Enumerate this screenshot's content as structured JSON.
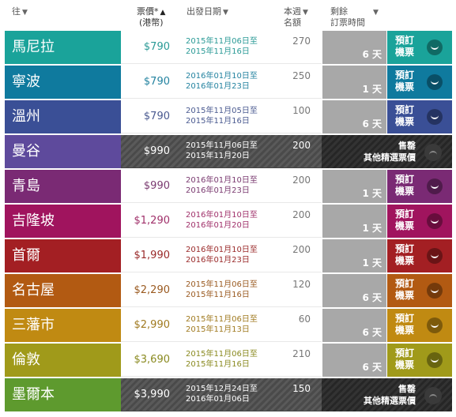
{
  "header": {
    "dest": "往",
    "price": "票價*",
    "price_sub": "(港幣)",
    "date": "出發日期",
    "quota": "本週",
    "quota_sub": "名額",
    "remain": "剩餘",
    "remain_sub": "訂票時間",
    "sort_arrow": "▼",
    "sort_active": "▲"
  },
  "labels": {
    "book_line1": "預訂",
    "book_line2": "機票",
    "sold_line1": "售罄",
    "sold_line2": "其他精選票價"
  },
  "rows": [
    {
      "dest": "馬尼拉",
      "price": "$790",
      "date_from": "2015年11月06日至",
      "date_to": "2015年11月16日",
      "quota": "270",
      "days": "6 天",
      "sold": false,
      "color": "#1aa39a",
      "text_color": "#2a9a96"
    },
    {
      "dest": "寧波",
      "price": "$790",
      "date_from": "2016年01月10日至",
      "date_to": "2016年01月23日",
      "quota": "250",
      "days": "1 天",
      "sold": false,
      "color": "#0f7a9e",
      "text_color": "#2483a0"
    },
    {
      "dest": "溫州",
      "price": "$790",
      "date_from": "2015年11月05日至",
      "date_to": "2015年11月16日",
      "quota": "100",
      "days": "6 天",
      "sold": false,
      "color": "#3a4f96",
      "text_color": "#4a5a90"
    },
    {
      "dest": "曼谷",
      "price": "$990",
      "date_from": "2015年11月06日至",
      "date_to": "2015年11月20日",
      "quota": "200",
      "days": "",
      "sold": true,
      "color": "#5e4a9c",
      "text_color": "#ffffff"
    },
    {
      "dest": "青島",
      "price": "$990",
      "date_from": "2016年01月10日至",
      "date_to": "2016年01月23日",
      "quota": "200",
      "days": "1 天",
      "sold": false,
      "color": "#7a2a74",
      "text_color": "#7a3a70"
    },
    {
      "dest": "吉隆坡",
      "price": "$1,290",
      "date_from": "2016年01月10日至",
      "date_to": "2016年01月20日",
      "quota": "200",
      "days": "1 天",
      "sold": false,
      "color": "#a0145e",
      "text_color": "#a0306a"
    },
    {
      "dest": "首爾",
      "price": "$1,990",
      "date_from": "2016年01月10日至",
      "date_to": "2016年01月23日",
      "quota": "200",
      "days": "1 天",
      "sold": false,
      "color": "#a31f23",
      "text_color": "#9a2a2a"
    },
    {
      "dest": "名古屋",
      "price": "$2,290",
      "date_from": "2015年11月06日至",
      "date_to": "2015年11月16日",
      "quota": "120",
      "days": "6 天",
      "sold": false,
      "color": "#b25a12",
      "text_color": "#9a5a20"
    },
    {
      "dest": "三藩市",
      "price": "$2,990",
      "date_from": "2015年11月06日至",
      "date_to": "2015年11月13日",
      "quota": "60",
      "days": "6 天",
      "sold": false,
      "color": "#c08a12",
      "text_color": "#a07a20"
    },
    {
      "dest": "倫敦",
      "price": "$3,690",
      "date_from": "2015年11月06日至",
      "date_to": "2015年11月16日",
      "quota": "210",
      "days": "6 天",
      "sold": false,
      "color": "#a09a1a",
      "text_color": "#8a8a20"
    },
    {
      "dest": "墨爾本",
      "price": "$3,990",
      "date_from": "2015年12月24日至",
      "date_to": "2016年01月06日",
      "quota": "150",
      "days": "",
      "sold": true,
      "color": "#5e9a2e",
      "text_color": "#ffffff"
    }
  ]
}
